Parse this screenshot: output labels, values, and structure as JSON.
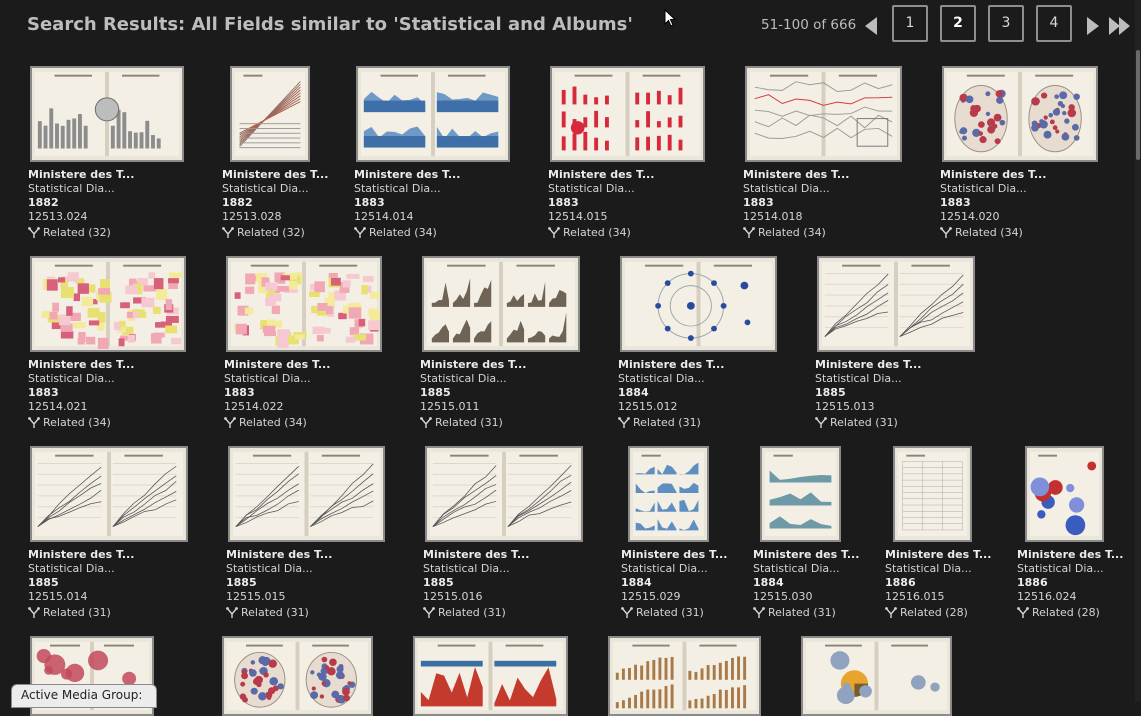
{
  "header": {
    "title": "Search Results: All Fields similar to 'Statistical and Albums'",
    "range": "51-100 of 666",
    "pages": [
      "1",
      "2",
      "3",
      "4"
    ],
    "current_page": "2"
  },
  "items": [
    {
      "title": "Ministere des T...",
      "subtitle": "Statistical Dia...",
      "year": "1882",
      "id": "12513.024",
      "related": "Related (32)",
      "art": "mixed"
    },
    {
      "title": "Ministere des T...",
      "subtitle": "Statistical Dia...",
      "year": "1882",
      "id": "12513.028",
      "related": "Related (32)",
      "art": "diagonal"
    },
    {
      "title": "Ministere des T...",
      "subtitle": "Statistical Dia...",
      "year": "1883",
      "id": "12514.014",
      "related": "Related (34)",
      "art": "blue-area"
    },
    {
      "title": "Ministere des T...",
      "subtitle": "Statistical Dia...",
      "year": "1883",
      "id": "12514.015",
      "related": "Related (34)",
      "art": "red-bars"
    },
    {
      "title": "Ministere des T...",
      "subtitle": "Statistical Dia...",
      "year": "1883",
      "id": "12514.018",
      "related": "Related (34)",
      "art": "map-lines"
    },
    {
      "title": "Ministere des T...",
      "subtitle": "Statistical Dia...",
      "year": "1883",
      "id": "12514.020",
      "related": "Related (34)",
      "art": "map-dots"
    },
    {
      "title": "Ministere des T...",
      "subtitle": "Statistical Dia...",
      "year": "1883",
      "id": "12514.021",
      "related": "Related (34)",
      "art": "map-pink"
    },
    {
      "title": "Ministere des T...",
      "subtitle": "Statistical Dia...",
      "year": "1883",
      "id": "12514.022",
      "related": "Related (34)",
      "art": "map-pink"
    },
    {
      "title": "Ministere des T...",
      "subtitle": "Statistical Dia...",
      "year": "1885",
      "id": "12515.011",
      "related": "Related (31)",
      "art": "brown-area"
    },
    {
      "title": "Ministere des T...",
      "subtitle": "Statistical Dia...",
      "year": "1884",
      "id": "12515.012",
      "related": "Related (31)",
      "art": "radial"
    },
    {
      "title": "Ministere des T...",
      "subtitle": "Statistical Dia...",
      "year": "1885",
      "id": "12515.013",
      "related": "Related (31)",
      "art": "lines"
    },
    {
      "title": "Ministere des T...",
      "subtitle": "Statistical Dia...",
      "year": "1885",
      "id": "12515.014",
      "related": "Related (31)",
      "art": "lines"
    },
    {
      "title": "Ministere des T...",
      "subtitle": "Statistical Dia...",
      "year": "1885",
      "id": "12515.015",
      "related": "Related (31)",
      "art": "lines"
    },
    {
      "title": "Ministere des T...",
      "subtitle": "Statistical Dia...",
      "year": "1885",
      "id": "12515.016",
      "related": "Related (31)",
      "art": "lines"
    },
    {
      "title": "Ministere des T...",
      "subtitle": "Statistical Dia...",
      "year": "1884",
      "id": "12515.029",
      "related": "Related (31)",
      "art": "blue-grid"
    },
    {
      "title": "Ministere des T...",
      "subtitle": "Statistical Dia...",
      "year": "1884",
      "id": "12515.030",
      "related": "Related (31)",
      "art": "teal-area"
    },
    {
      "title": "Ministere des T...",
      "subtitle": "Statistical Dia...",
      "year": "1886",
      "id": "12516.015",
      "related": "Related (28)",
      "art": "table"
    },
    {
      "title": "Ministere des T...",
      "subtitle": "Statistical Dia...",
      "year": "1886",
      "id": "12516.024",
      "related": "Related (28)",
      "art": "circles"
    },
    {
      "art": "circles-red"
    },
    {
      "art": "map-dots"
    },
    {
      "art": "red-area"
    },
    {
      "art": "brown-bars"
    },
    {
      "art": "pie-map"
    }
  ],
  "active_media_group": "Active Media Group:",
  "colors": {
    "background": "#1c1b1b",
    "text": "#d8d8d8",
    "header_text": "#bdbdbd",
    "button_border": "#8f8f8f"
  }
}
